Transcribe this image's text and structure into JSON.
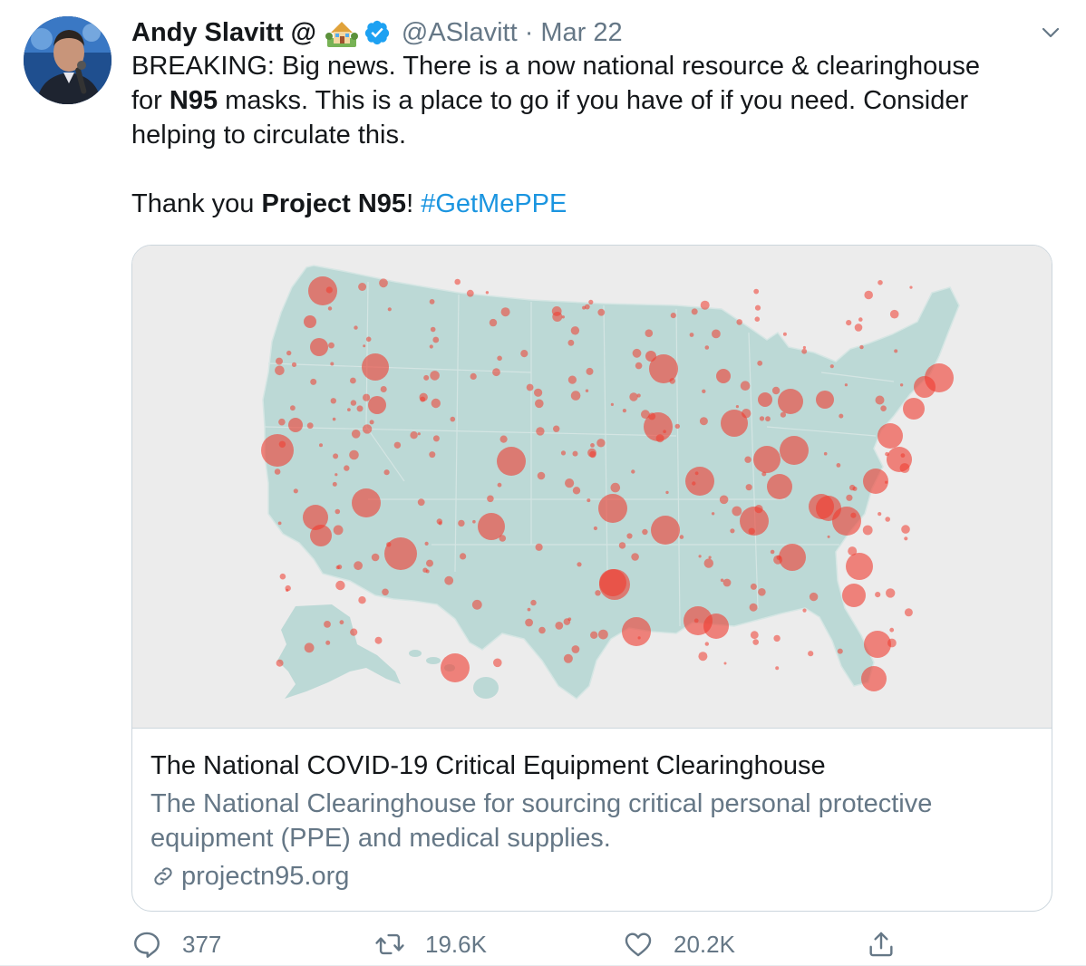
{
  "author": {
    "display_name": "Andy Slavitt @",
    "handle": "@ASlavitt",
    "separator": "·",
    "date": "Mar 22"
  },
  "tweet": {
    "line1": "BREAKING:  Big news. There is a now national resource & clearinghouse",
    "line2_pre": "for ",
    "line2_bold": "N95",
    "line2_post": " masks. This is a place to go if you have of if you need. Consider",
    "line3": "helping to circulate this.",
    "thanks_pre": "Thank you ",
    "thanks_bold": "Project N95",
    "thanks_post": "! ",
    "hashtag": "#GetMePPE"
  },
  "card": {
    "title": "The National COVID-19 Critical Equipment Clearinghouse",
    "description_line1": "The National Clearinghouse for sourcing critical personal protective",
    "description_line2": "equipment (PPE) and medical supplies.",
    "domain": "projectn95.org"
  },
  "actions": {
    "replies": "377",
    "retweets": "19.6K",
    "likes": "20.2K"
  },
  "icons": {
    "avatar": "avatar-photo",
    "emoji": "house-with-garden-emoji",
    "verified": "verified-badge-icon",
    "caret": "chevron-down-icon",
    "link": "link-icon",
    "reply": "reply-icon",
    "retweet": "retweet-icon",
    "like": "heart-icon",
    "share": "share-icon"
  },
  "colors": {
    "link_blue": "#1b95e0",
    "muted": "#657786",
    "map_land": "#bcd9d6",
    "hotspot": "#f03a2e"
  }
}
